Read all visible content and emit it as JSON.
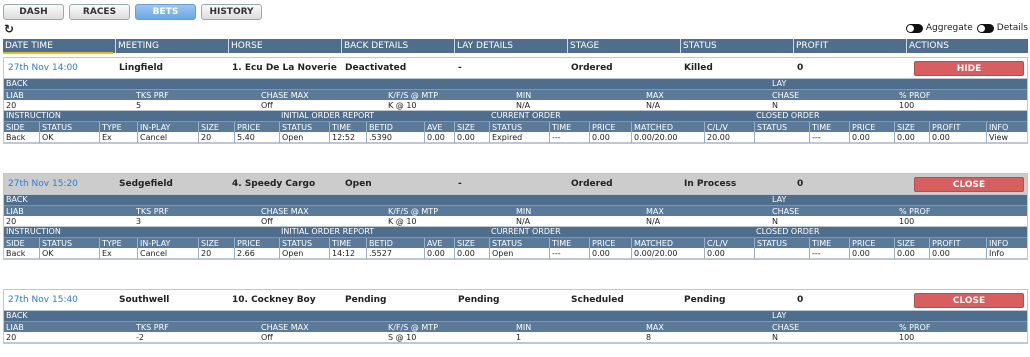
{
  "nav": {
    "tabs": [
      {
        "label": "DASH",
        "active": false
      },
      {
        "label": "RACES",
        "active": false
      },
      {
        "label": "BETS",
        "active": true
      },
      {
        "label": "HISTORY",
        "active": false
      }
    ]
  },
  "toolbar": {
    "refresh_icon": "↻",
    "aggregate_label": "Aggregate",
    "details_label": "Details"
  },
  "main_headers": [
    "DATE TIME",
    "MEETING",
    "HORSE",
    "BACK DETAILS",
    "LAY DETAILS",
    "STAGE",
    "STATUS",
    "PROFIT",
    "ACTIONS"
  ],
  "labels": {
    "back": "BACK",
    "lay": "LAY",
    "back_headers": [
      "LIAB",
      "TKS PRF",
      "CHASE MAX",
      "K/F/S @ MTP",
      "MIN",
      "MAX",
      "CHASE",
      "% PROF"
    ],
    "instruction": "INSTRUCTION",
    "initial_order_report": "INITIAL ORDER REPORT",
    "current_order": "CURRENT ORDER",
    "closed_order": "CLOSED ORDER",
    "order_headers": [
      "SIDE",
      "STATUS",
      "TYPE",
      "IN-PLAY",
      "SIZE",
      "PRICE",
      "STATUS",
      "TIME",
      "BETID",
      "AVE",
      "SIZE",
      "STATUS",
      "TIME",
      "PRICE",
      "MATCHED",
      "C/L/V",
      "STATUS",
      "TIME",
      "PRICE",
      "SIZE",
      "PROFIT",
      "INFO"
    ]
  },
  "bets": [
    {
      "date": "27th Nov 14:00",
      "meeting": "Lingfield",
      "horse": "1. Ecu De La Noverie",
      "back_details": "Deactivated",
      "lay_details": "-",
      "stage": "Ordered",
      "status": "Killed",
      "profit": "0",
      "action": "HIDE",
      "back_values": [
        "20",
        "5",
        "Off",
        "K @ 10",
        "N/A",
        "N/A",
        "N",
        "100"
      ],
      "order_values": [
        "Back",
        "OK",
        "Ex",
        "Cancel",
        "20",
        "5.40",
        "Open",
        "12:52",
        ".5390",
        "0.00",
        "0.00",
        "Expired",
        "---",
        "0.00",
        "0.00/20.00",
        "20.00",
        "",
        "---",
        "0.00",
        "0.00",
        "0.00",
        "View"
      ]
    },
    {
      "date": "27th Nov 15:20",
      "meeting": "Sedgefield",
      "horse": "4. Speedy Cargo",
      "back_details": "Open",
      "lay_details": "-",
      "stage": "Ordered",
      "status": "In Process",
      "profit": "0",
      "action": "CLOSE",
      "back_values": [
        "20",
        "3",
        "Off",
        "K @ 10",
        "N/A",
        "N/A",
        "N",
        "100"
      ],
      "order_values": [
        "Back",
        "OK",
        "Ex",
        "Cancel",
        "20",
        "2.66",
        "Open",
        "14:12",
        ".5527",
        "0.00",
        "0.00",
        "Open",
        "---",
        "0.00",
        "0.00/20.00",
        "0.00",
        "",
        "---",
        "0.00",
        "0.00",
        "0.00",
        "Info"
      ]
    },
    {
      "date": "27th Nov 15:40",
      "meeting": "Southwell",
      "horse": "10. Cockney Boy",
      "back_details": "Pending",
      "lay_details": "Pending",
      "stage": "Scheduled",
      "status": "Pending",
      "profit": "0",
      "action": "CLOSE",
      "back_values": [
        "20",
        "-2",
        "Off",
        "S @ 10",
        "1",
        "8",
        "N",
        "100"
      ]
    }
  ]
}
